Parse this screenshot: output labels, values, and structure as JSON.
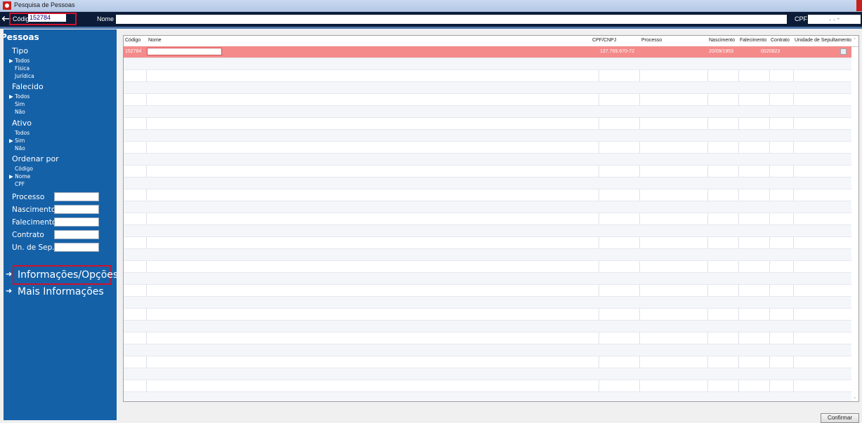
{
  "window": {
    "title": "Pesquisa de Pessoas"
  },
  "topbar": {
    "codigo_label": "Código",
    "codigo_value": "152784",
    "nome_label": "Nome",
    "nome_value": "",
    "cpf_label": "CPF",
    "cpf_value": ". . -"
  },
  "sidebar": {
    "title": "Pessoas",
    "tipo": {
      "label": "Tipo",
      "options": [
        "Todos",
        "Física",
        "Jurídica"
      ],
      "selected": "Todos"
    },
    "falecido": {
      "label": "Falecido",
      "options": [
        "Todos",
        "Sim",
        "Não"
      ],
      "selected": "Todos"
    },
    "ativo": {
      "label": "Ativo",
      "options": [
        "Todos",
        "Sim",
        "Não"
      ],
      "selected": "Sim"
    },
    "ordenar": {
      "label": "Ordenar por",
      "options": [
        "Código",
        "Nome",
        "CPF"
      ],
      "selected": "Nome"
    },
    "fields": {
      "processo": "Processo",
      "nascimento": "Nascimento",
      "falecimento": "Falecimento",
      "contrato": "Contrato",
      "un_sep": "Un. de Sep."
    },
    "links": {
      "info": "Informações/Opções",
      "mais": "Mais Informações"
    },
    "selected_marker": "▶"
  },
  "grid": {
    "columns": [
      "Código",
      "Nome",
      "CPF/CNPJ",
      "Processo",
      "Nascimento",
      "Falecimento",
      "Contrato",
      "Unidade de Sepultamento"
    ],
    "rows": [
      {
        "codigo": "152784",
        "nome": "",
        "cpf": "137.769.670-72",
        "processo": "",
        "nascimento": "20/09/1953",
        "falecimento": "",
        "contrato": "0020823",
        "unidade": ""
      }
    ]
  },
  "buttons": {
    "confirm": "Confirmar"
  },
  "colors": {
    "selected_row": "#f48a8a",
    "sidebar": "#1561a8",
    "highlight_border": "#d0112b"
  }
}
